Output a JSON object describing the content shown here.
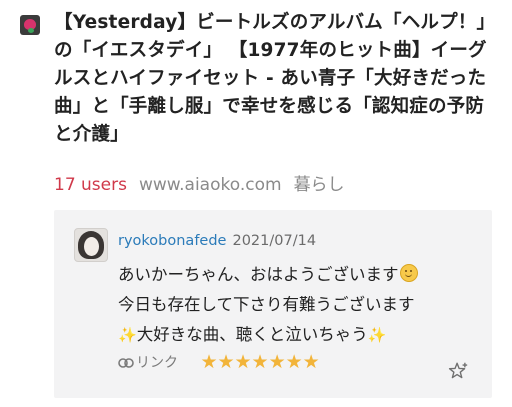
{
  "entry": {
    "title": "【Yesterday】ビートルズのアルバム「ヘルプ！」の「イエスタデイ」 【1977年のヒット曲】イーグルスとハイファイセット - あい青子「大好きだった曲」と「手離し服」で幸せを感じる「認知症の予防と介護」",
    "users": "17 users",
    "domain": "www.aiaoko.com",
    "category": "暮らし"
  },
  "comment": {
    "username": "ryokobonafede",
    "date": "2021/07/14",
    "line1": "あいかーちゃん、おはようございます",
    "line2": "今日も存在して下さり有難うございます",
    "line3": "大好きな曲、聴くと泣いちゃう",
    "sparkle": "✨",
    "link_label": "リンク",
    "stars": "★★★★★★★",
    "star_count": 7
  },
  "icons": {
    "favicon": "site-favicon",
    "avatar": "user-avatar",
    "link": "link-chain-icon",
    "add_star": "star-add-icon",
    "smile": "smiling-face-emoji"
  },
  "colors": {
    "users": "#d0394a",
    "username": "#2b7bb9",
    "stars": "#f2b43a",
    "comment_bg": "#f3f3f4",
    "meta_gray": "#8a8a8a"
  }
}
